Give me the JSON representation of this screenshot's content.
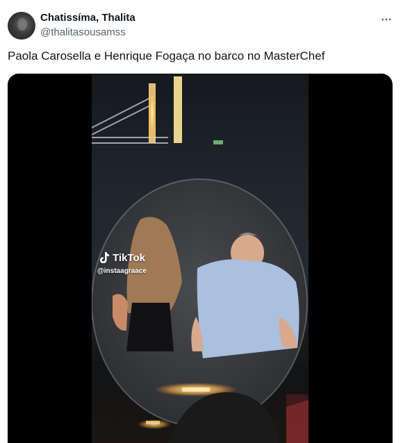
{
  "tweet": {
    "display_name": "Chatissíma, Thalita",
    "handle": "@thalitasousamss",
    "text": "Paola Carosella e Henrique Fogaça no barco no MasterChef",
    "more_icon": "ellipsis-icon"
  },
  "media": {
    "watermark_brand": "TikTok",
    "watermark_handle": "@instaagraace"
  }
}
